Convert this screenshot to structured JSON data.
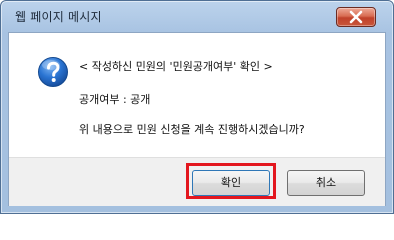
{
  "dialog": {
    "title": "웹 페이지 메시지",
    "close_icon": "close-x-icon",
    "info_icon": "question-mark-icon",
    "messages": [
      "< 작성하신 민원의 '민원공개여부' 확인 >",
      "공개여부 : 공개",
      "위 내용으로 민원 신청을 계속 진행하시겠습니까?"
    ],
    "buttons": {
      "ok_label": "확인",
      "cancel_label": "취소"
    },
    "colors": {
      "title_bar": "#a8c3e2",
      "close_button": "#c94b31",
      "highlight": "#e3161e",
      "icon_blue": "#1f69c9"
    }
  }
}
